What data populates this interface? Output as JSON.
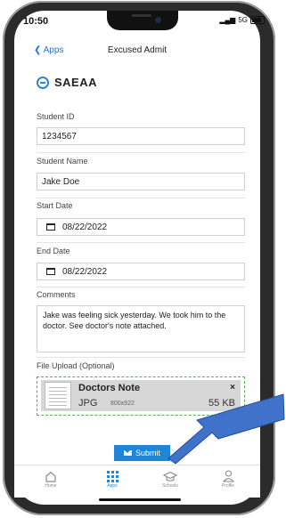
{
  "status_bar": {
    "time": "10:50",
    "network": "5G"
  },
  "nav": {
    "back_label": "Apps",
    "title": "Excused Admit"
  },
  "brand": {
    "name": "SAEAA"
  },
  "form": {
    "student_id": {
      "label": "Student ID",
      "value": "1234567"
    },
    "student_name": {
      "label": "Student Name",
      "value": "Jake Doe"
    },
    "start_date": {
      "label": "Start Date",
      "value": "08/22/2022"
    },
    "end_date": {
      "label": "End Date",
      "value": "08/22/2022"
    },
    "comments": {
      "label": "Comments",
      "value": "Jake was feeling sick yesterday. We took him to the doctor. See doctor's note attached."
    },
    "file_upload": {
      "label": "File Upload (Optional)",
      "file": {
        "name": "Doctors Note",
        "type": "JPG",
        "dimensions": "800x922",
        "size": "55 KB",
        "remove": "×"
      }
    }
  },
  "submit": {
    "label": "Submit"
  },
  "tabbar": {
    "items": [
      {
        "label": "Home",
        "icon": "home-icon",
        "active": false
      },
      {
        "label": "Apps",
        "icon": "grid-icon",
        "active": true
      },
      {
        "label": "Schools",
        "icon": "school-icon",
        "active": false
      },
      {
        "label": "Profile",
        "icon": "person-icon",
        "active": false
      }
    ]
  },
  "colors": {
    "accent": "#1e86d6",
    "upload_border": "#5cae5c",
    "arrow": "#3f72c8"
  }
}
